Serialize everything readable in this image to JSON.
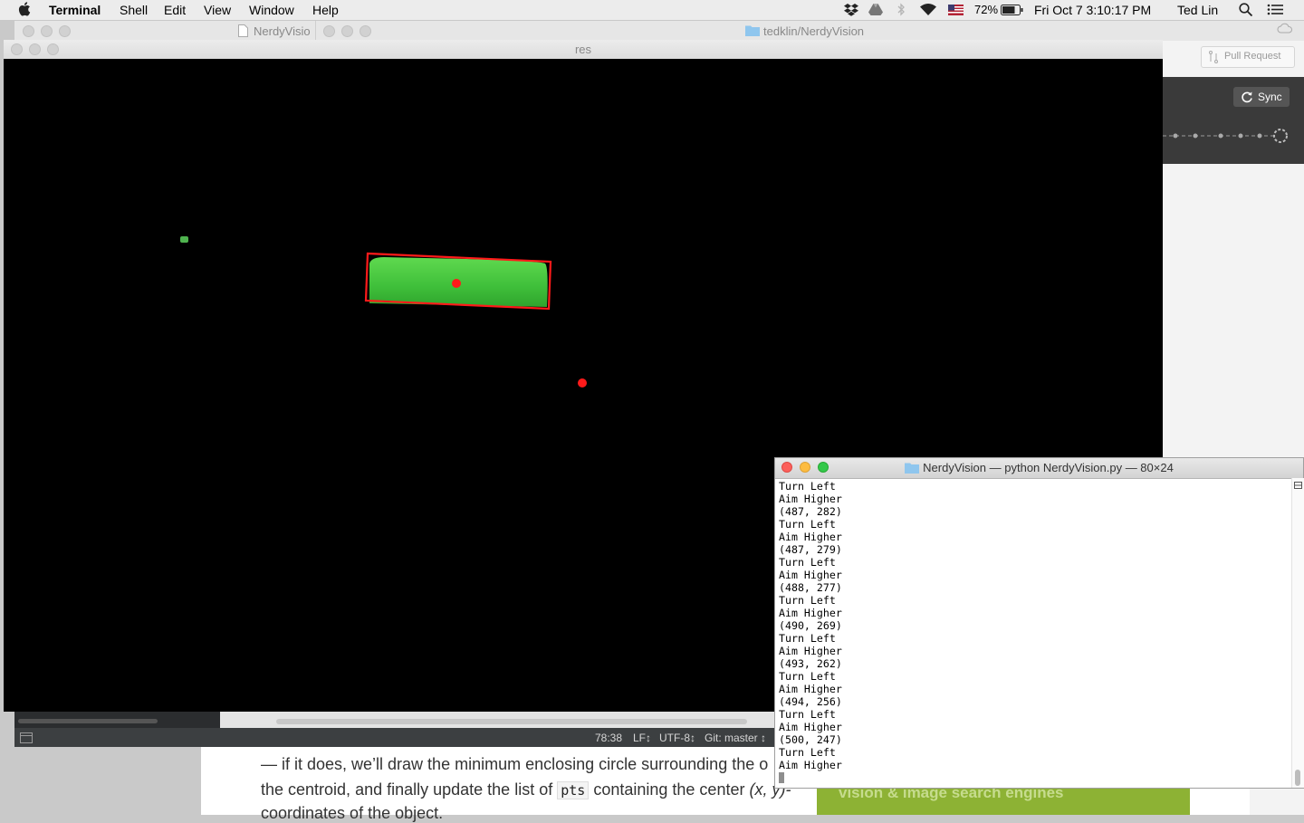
{
  "menubar": {
    "app_name": "Terminal",
    "items": [
      "Shell",
      "Edit",
      "View",
      "Window",
      "Help"
    ],
    "battery": "72%",
    "datetime": "Fri Oct 7  3:10:17 PM",
    "user": "Ted Lin",
    "icons": [
      "apple-icon",
      "dropbox-icon",
      "drive-icon",
      "bluetooth-icon",
      "wifi-icon",
      "flag-icon",
      "battery-icon",
      "search-icon",
      "list-icon"
    ]
  },
  "background_windows": {
    "left_title": "NerdyVisio",
    "right_title": "tedklin/NerdyVision",
    "pull_request_label": "Pull Request",
    "sync_label": "Sync"
  },
  "res_window": {
    "title": "res"
  },
  "editor_status": {
    "cursor_pos": "78:38",
    "line_ending": "LF",
    "encoding": "UTF-8",
    "git_branch": "Git: master"
  },
  "webpage": {
    "line1": "— if it does, we’ll draw the minimum enclosing circle surrounding the o",
    "line2_before": "the centroid, and finally update the list of",
    "line2_code": "pts",
    "line2_after": "containing the center",
    "line2_italic": "(x, y)-",
    "line3": "coordinates of the object.",
    "ad_text": "vision & image search engines"
  },
  "terminal": {
    "title": "NerdyVision — python NerdyVision.py — 80×24",
    "lines": [
      "Turn Left",
      "Aim Higher",
      "(487, 282)",
      "Turn Left",
      "Aim Higher",
      "(487, 279)",
      "Turn Left",
      "Aim Higher",
      "(488, 277)",
      "Turn Left",
      "Aim Higher",
      "(490, 269)",
      "Turn Left",
      "Aim Higher",
      "(493, 262)",
      "Turn Left",
      "Aim Higher",
      "(494, 256)",
      "Turn Left",
      "Aim Higher",
      "(500, 247)",
      "Turn Left",
      "Aim Higher"
    ]
  },
  "colors": {
    "target_green": "#3cc03c",
    "marker_red": "#ff1a1a",
    "ad_green": "#8db234"
  }
}
